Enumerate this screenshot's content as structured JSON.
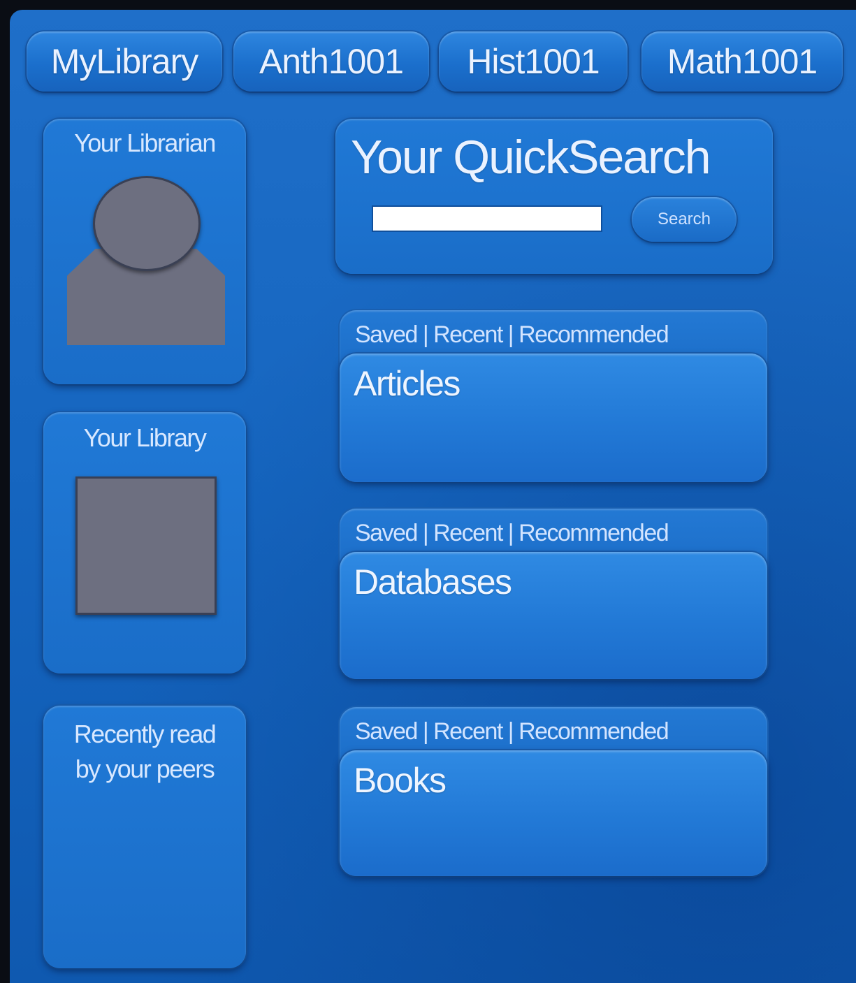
{
  "tabs": [
    "MyLibrary",
    "Anth1001",
    "Hist1001",
    "Math1001"
  ],
  "sidebar": {
    "librarian_title": "Your Librarian",
    "library_title": "Your Library",
    "peers_title_line1": "Recently read",
    "peers_title_line2": "by your peers"
  },
  "quicksearch": {
    "title": "Your QuickSearch",
    "input_value": "",
    "button_label": "Search"
  },
  "sections": [
    {
      "links": "Saved | Recent | Recommended",
      "title": "Articles"
    },
    {
      "links": "Saved | Recent | Recommended",
      "title": "Databases"
    },
    {
      "links": "Saved | Recent | Recommended",
      "title": "Books"
    }
  ],
  "colors": {
    "background": "#1a6dc8",
    "placeholder_gray": "#6d6f80",
    "frame_border": "#0a0d14"
  },
  "icons": [
    "librarian-avatar-icon",
    "library-book-icon"
  ]
}
